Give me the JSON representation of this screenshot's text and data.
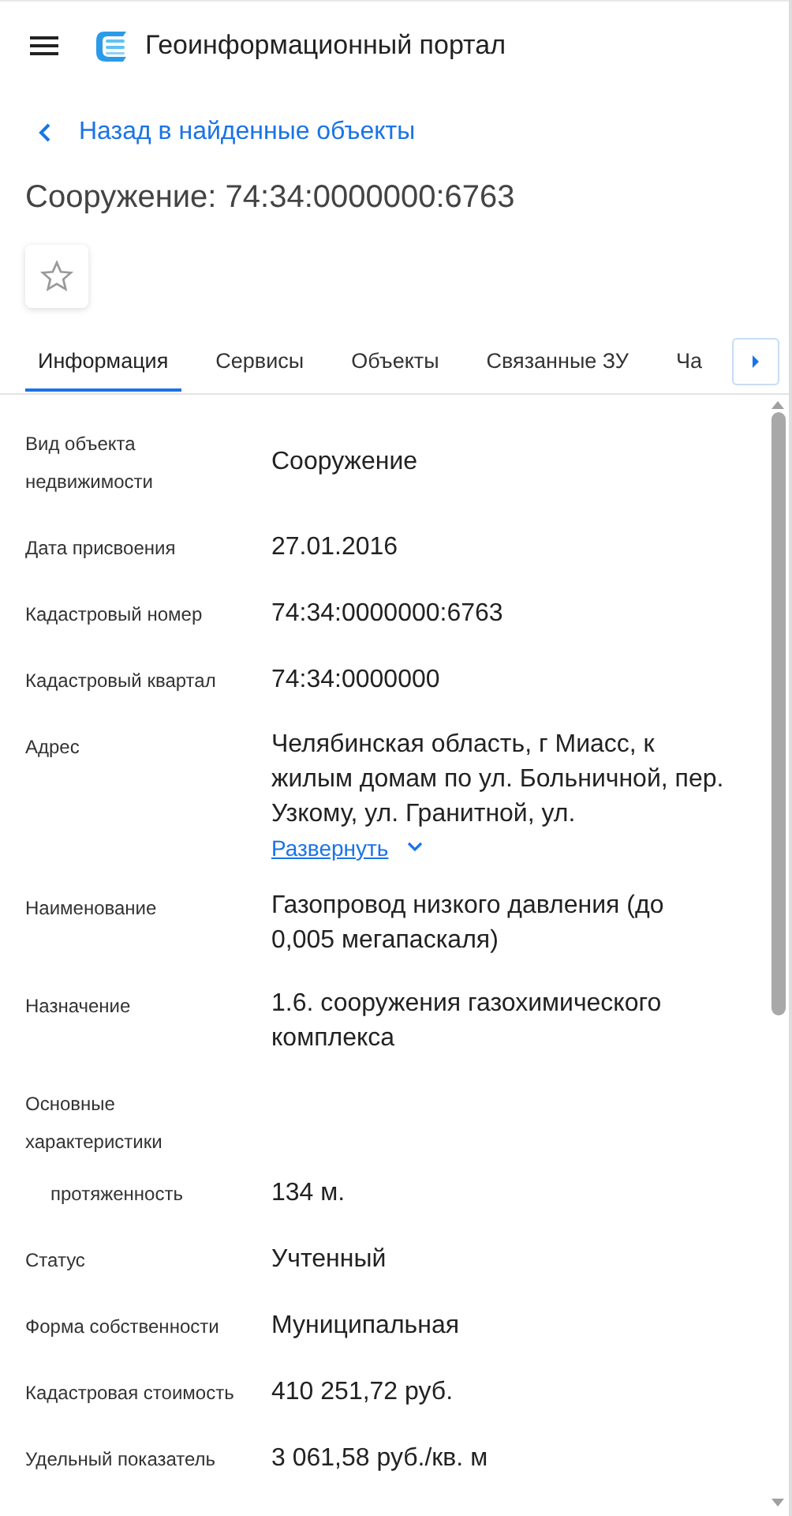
{
  "header": {
    "title": "Геоинформационный портал"
  },
  "back_link": "Назад в найденные объекты",
  "title": "Сооружение: 74:34:0000000:6763",
  "favorite": {
    "on": false
  },
  "tabs": [
    {
      "label": "Информация",
      "selected": true
    },
    {
      "label": "Сервисы",
      "selected": false
    },
    {
      "label": "Объекты",
      "selected": false
    },
    {
      "label": "Связанные ЗУ",
      "selected": false
    },
    {
      "label": "Ча",
      "selected": false
    }
  ],
  "fields": [
    {
      "kind": "field",
      "label": "Вид объекта недвижимости",
      "value": "Сооружение"
    },
    {
      "kind": "field",
      "label": "Дата присвоения",
      "value": "27.01.2016"
    },
    {
      "kind": "field",
      "label": "Кадастровый номер",
      "value": "74:34:0000000:6763"
    },
    {
      "kind": "field",
      "label": "Кадастровый квартал",
      "value": "74:34:0000000"
    },
    {
      "kind": "field",
      "label": "Адрес",
      "value": "Челябинская область, г Миасс, к жилым домам по ул. Больничной, пер. Узкому, ул. Гранитной, ул.",
      "more_link": "Развернуть",
      "expanded": false
    },
    {
      "kind": "field",
      "label": "Наименование",
      "value": "Газопровод низкого давления (до 0,005 мегапаскаля)"
    },
    {
      "kind": "field",
      "label": "Назначение",
      "value": "1.6. сооружения газохимического комплекса"
    },
    {
      "kind": "group",
      "label": "Основные характеристики"
    },
    {
      "kind": "sub",
      "label": "протяженность",
      "value": "134 м."
    },
    {
      "kind": "field",
      "label": "Статус",
      "value": "Учтенный"
    },
    {
      "kind": "field",
      "label": "Форма собственности",
      "value": "Муниципальная"
    },
    {
      "kind": "field",
      "label": "Кадастровая стоимость",
      "value": "410 251,72 руб."
    },
    {
      "kind": "field",
      "label": "Удельный показатель",
      "value": "3 061,58 руб./кв. м"
    }
  ]
}
